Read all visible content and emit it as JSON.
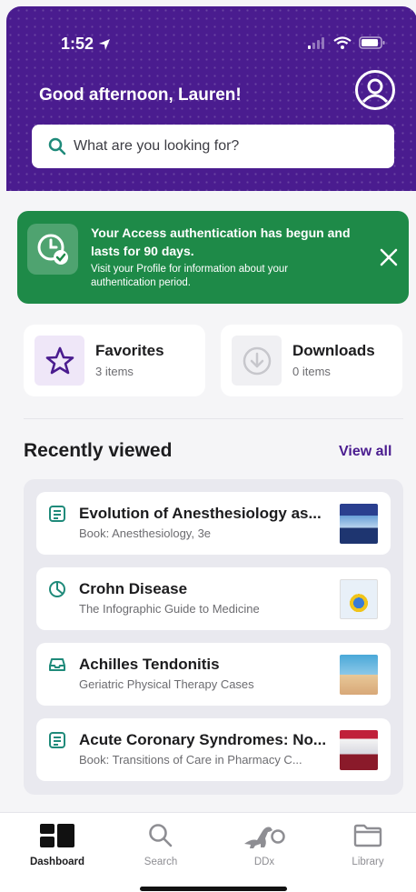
{
  "status_bar": {
    "time": "1:52"
  },
  "header": {
    "greeting": "Good afternoon, Lauren!",
    "search_placeholder": "What are you looking for?"
  },
  "banner": {
    "title": "Your Access authentication has begun and lasts for 90 days.",
    "body": "Visit your Profile for information about your authentication period.",
    "color": "#1e8a48"
  },
  "quick_cards": [
    {
      "title": "Favorites",
      "subtitle": "3 items",
      "icon": "star-icon"
    },
    {
      "title": "Downloads",
      "subtitle": "0 items",
      "icon": "download-icon"
    }
  ],
  "recently_viewed": {
    "heading": "Recently viewed",
    "view_all_label": "View all",
    "items": [
      {
        "title": "Evolution of Anesthesiology as...",
        "subtitle": "Book: Anesthesiology, 3e",
        "icon": "book-icon"
      },
      {
        "title": "Crohn Disease",
        "subtitle": "The Infographic Guide to Medicine",
        "icon": "pie-chart-icon"
      },
      {
        "title": "Achilles Tendonitis",
        "subtitle": "Geriatric Physical Therapy Cases",
        "icon": "inbox-icon"
      },
      {
        "title": "Acute Coronary Syndromes: No...",
        "subtitle": "Book: Transitions of Care in Pharmacy C...",
        "icon": "book-icon"
      }
    ]
  },
  "tabs": [
    {
      "label": "Dashboard",
      "icon": "dashboard-icon",
      "active": true
    },
    {
      "label": "Search",
      "icon": "search-icon",
      "active": false
    },
    {
      "label": "DDx",
      "icon": "dinosaur-icon",
      "active": false
    },
    {
      "label": "Library",
      "icon": "folder-icon",
      "active": false
    }
  ],
  "colors": {
    "brand": "#4a1c8f",
    "success": "#1e8a48",
    "icon_teal": "#1f8a7a"
  }
}
